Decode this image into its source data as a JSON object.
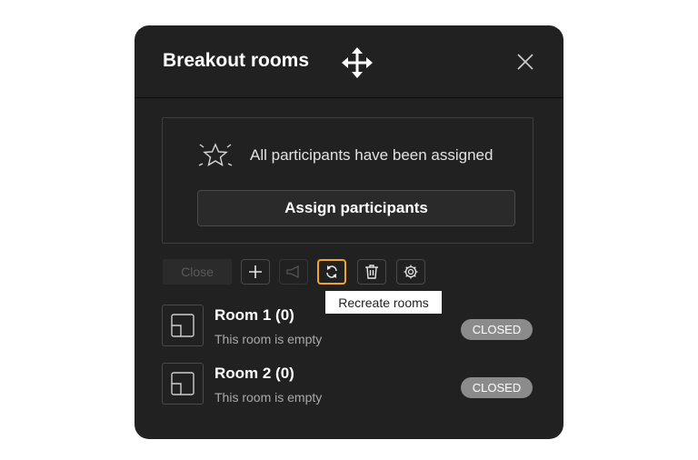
{
  "header": {
    "title": "Breakout rooms"
  },
  "assign_panel": {
    "message": "All participants have been assigned",
    "assign_label": "Assign participants"
  },
  "toolbar": {
    "close_label": "Close",
    "icons": [
      "plus-icon",
      "megaphone-icon",
      "recreate-icon",
      "trash-icon",
      "gear-icon"
    ],
    "tooltip": "Recreate rooms"
  },
  "rooms": [
    {
      "name": "Room 1 (0)",
      "status": "This room is empty",
      "badge": "CLOSED"
    },
    {
      "name": "Room 2 (0)",
      "status": "This room is empty",
      "badge": "CLOSED"
    }
  ],
  "colors": {
    "panel": "#222122",
    "highlight": "#f0a32e",
    "badge": "#8b8b8b"
  }
}
